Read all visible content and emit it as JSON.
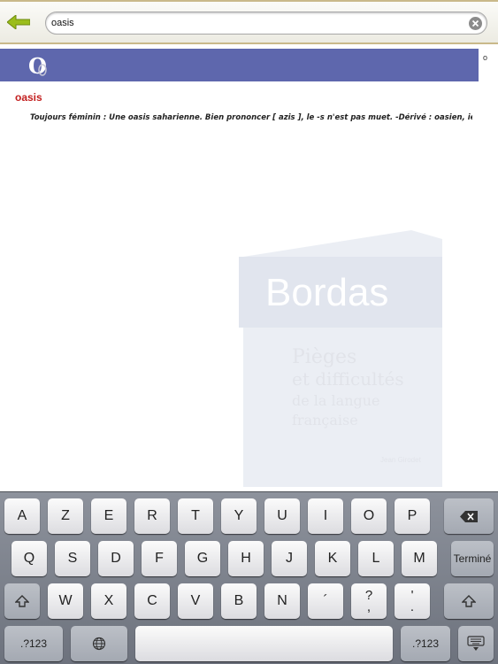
{
  "search": {
    "value": "oasis",
    "placeholder": ""
  },
  "header": {
    "logo_letter": "O",
    "side_marker": "o"
  },
  "entry": {
    "title": "oasis",
    "text": "Toujours féminin : Une oasis saharienne. Bien prononcer [ azis ], le -s n'est pas muet. -Dérivé : oasien, ienne […"
  },
  "watermark": {
    "brand": "Bordas",
    "title_lines": [
      "Pièges",
      "et difficultés",
      "de la langue",
      "française"
    ],
    "author": "Jean Girodet"
  },
  "keyboard": {
    "row1": [
      "A",
      "Z",
      "E",
      "R",
      "T",
      "Y",
      "U",
      "I",
      "O",
      "P"
    ],
    "row2": [
      "Q",
      "S",
      "D",
      "F",
      "G",
      "H",
      "J",
      "K",
      "L",
      "M"
    ],
    "done_label": "Terminé",
    "row3": [
      "W",
      "X",
      "C",
      "V",
      "B",
      "N",
      "´"
    ],
    "punct1": {
      "top": "?",
      "bottom": ","
    },
    "punct2": {
      "top": "'",
      "bottom": "."
    },
    "numbers_label": ".?123"
  },
  "colors": {
    "accent_green": "#9bbd1b",
    "header_blue": "#5e67ad",
    "title_red": "#c32020"
  }
}
